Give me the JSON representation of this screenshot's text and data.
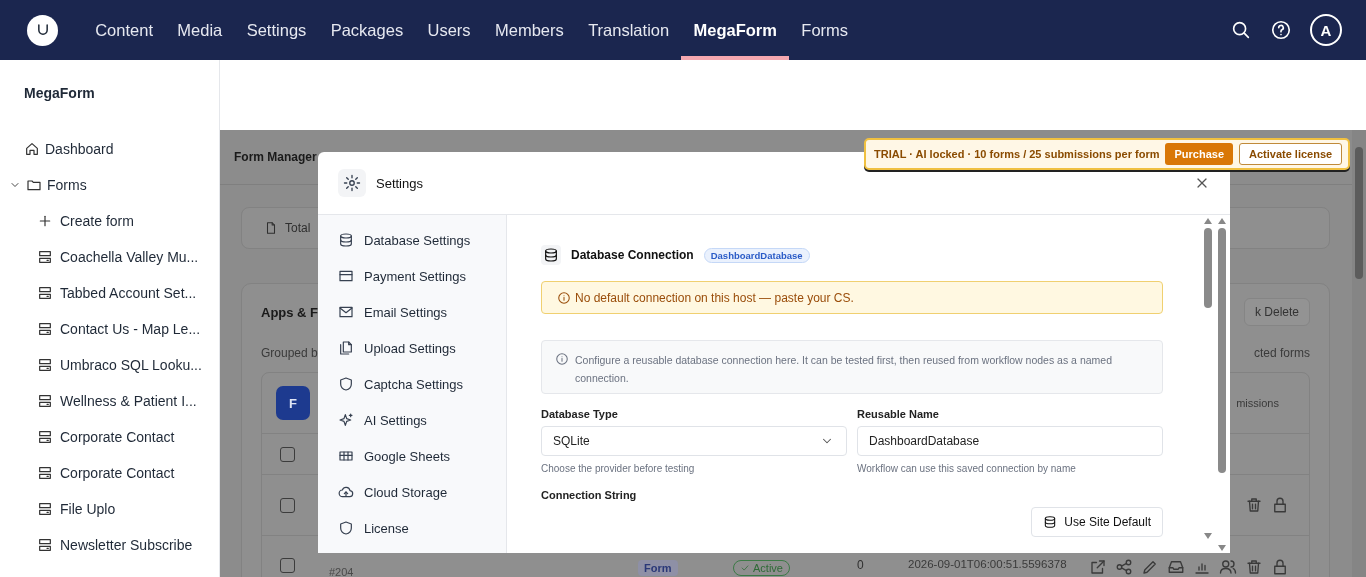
{
  "top_nav": {
    "items": [
      {
        "label": "Content",
        "selected": false
      },
      {
        "label": "Media",
        "selected": false
      },
      {
        "label": "Settings",
        "selected": false
      },
      {
        "label": "Packages",
        "selected": false
      },
      {
        "label": "Users",
        "selected": false
      },
      {
        "label": "Members",
        "selected": false
      },
      {
        "label": "Translation",
        "selected": false
      },
      {
        "label": "MegaForm",
        "selected": true
      },
      {
        "label": "Forms",
        "selected": false
      }
    ],
    "avatar": "A"
  },
  "sidebar": {
    "title": "MegaForm",
    "tree": [
      {
        "label": "Dashboard",
        "kind": "home"
      },
      {
        "label": "Forms",
        "kind": "folder",
        "expanded": true,
        "children": [
          {
            "label": "Create form",
            "kind": "create"
          },
          {
            "label": "Coachella Valley Mu...",
            "kind": "form"
          },
          {
            "label": "Tabbed Account Set...",
            "kind": "form"
          },
          {
            "label": "Contact Us - Map Le...",
            "kind": "form"
          },
          {
            "label": "Umbraco SQL Looku...",
            "kind": "form"
          },
          {
            "label": "Wellness & Patient I...",
            "kind": "form"
          },
          {
            "label": "Corporate Contact",
            "kind": "form"
          },
          {
            "label": "Corporate Contact",
            "kind": "form"
          },
          {
            "label": "File Uplo",
            "kind": "form"
          },
          {
            "label": "Newsletter Subscribe",
            "kind": "form"
          }
        ]
      }
    ]
  },
  "background": {
    "header_title": "Form Manager",
    "stats_label": "Total",
    "apps_title": "Apps & F",
    "grouped": "Grouped b",
    "bulk_button": "k Delete",
    "selected_forms": "cted forms",
    "avatar": "F",
    "column_header": "missions",
    "rows": [
      {
        "checked": false
      },
      {
        "checked": false
      },
      {
        "checked": false,
        "id": "#204",
        "type": "Form",
        "status": "Active",
        "count": "0",
        "date": "2026-09-01T06:00:51.5596378"
      }
    ]
  },
  "trial_banner": {
    "text": "TRIAL · AI locked · 10 forms / 25 submissions per form",
    "purchase": "Purchase",
    "activate": "Activate license"
  },
  "modal": {
    "title": "Settings",
    "nav": [
      {
        "label": "Database Settings"
      },
      {
        "label": "Payment Settings"
      },
      {
        "label": "Email Settings"
      },
      {
        "label": "Upload Settings"
      },
      {
        "label": "Captcha Settings"
      },
      {
        "label": "AI Settings"
      },
      {
        "label": "Google Sheets"
      },
      {
        "label": "Cloud Storage"
      },
      {
        "label": "License"
      }
    ],
    "section": {
      "title": "Database Connection",
      "badge": "DashboardDatabase",
      "warning": "No default connection on this host — paste your CS.",
      "info": "Configure a reusable database connection here. It can be tested first, then reused from workflow nodes as a named connection.",
      "fields": [
        {
          "label": "Database Type",
          "kind": "select",
          "value": "SQLite",
          "help": "Choose the provider before testing"
        },
        {
          "label": "Reusable Name",
          "kind": "text",
          "value": "DashboardDatabase",
          "help": "Workflow can use this saved connection by name"
        }
      ],
      "connection_label": "Connection String",
      "site_default_button": "Use Site Default"
    }
  }
}
